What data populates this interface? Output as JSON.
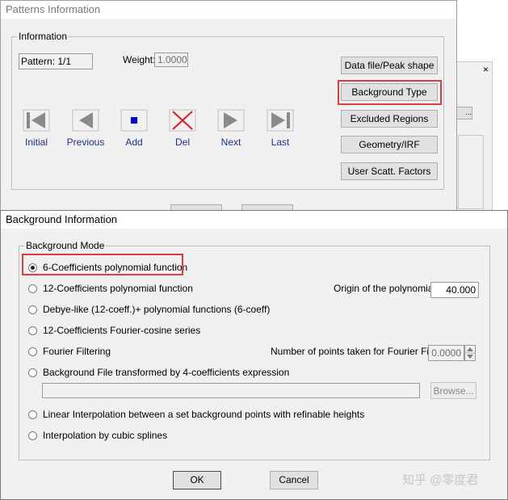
{
  "patterns_window": {
    "title": "Patterns Information",
    "group_label": "Information",
    "pattern_label": "Pattern: 1/1",
    "weight_label": "Weight:",
    "weight_value": "1.0000",
    "nav": [
      {
        "id": "initial",
        "label": "Initial",
        "icon": "first-icon"
      },
      {
        "id": "previous",
        "label": "Previous",
        "icon": "previous-icon"
      },
      {
        "id": "add",
        "label": "Add",
        "icon": "add-square-icon"
      },
      {
        "id": "del",
        "label": "Del",
        "icon": "delete-x-icon"
      },
      {
        "id": "next",
        "label": "Next",
        "icon": "next-icon"
      },
      {
        "id": "last",
        "label": "Last",
        "icon": "last-icon"
      }
    ],
    "buttons": {
      "data_file": "Data file/Peak shape",
      "background_type": "Background Type",
      "excluded_regions": "Excluded Regions",
      "geometry": "Geometry/IRF",
      "user_scatt": "User Scatt. Factors"
    }
  },
  "behind_window": {
    "button_text": "...",
    "close_glyph": "×"
  },
  "background_window": {
    "title": "Background Information",
    "group_label": "Background Mode",
    "options": [
      {
        "label": "6-Coefficients polynomial function",
        "selected": true
      },
      {
        "label": "12-Coefficients polynomial function",
        "selected": false
      },
      {
        "label": "Debye-like (12-coeff.)+ polynomial functions (6-coeff)",
        "selected": false
      },
      {
        "label": "12-Coefficients Fourier-cosine series",
        "selected": false
      },
      {
        "label": "Fourier Filtering",
        "selected": false
      },
      {
        "label": "Background File transformed by 4-coefficients expression",
        "selected": false
      },
      {
        "label": "Linear Interpolation between a set background points with refinable heights",
        "selected": false
      },
      {
        "label": "Interpolation by cubic splines",
        "selected": false
      }
    ],
    "origin_label": "Origin of the polynomial:",
    "origin_value": "40.000",
    "fourier_label": "Number of points taken for Fourier Filter:",
    "fourier_value": "0.0000",
    "file_path": "",
    "browse_label": "Browse...",
    "ok_label": "OK",
    "cancel_label": "Cancel"
  },
  "watermark": "知乎 @零度君",
  "colors": {
    "highlight": "#e03c3c",
    "nav_blue": "#1f2f8f",
    "add_blue": "#0000d0",
    "del_red": "#d42020"
  }
}
